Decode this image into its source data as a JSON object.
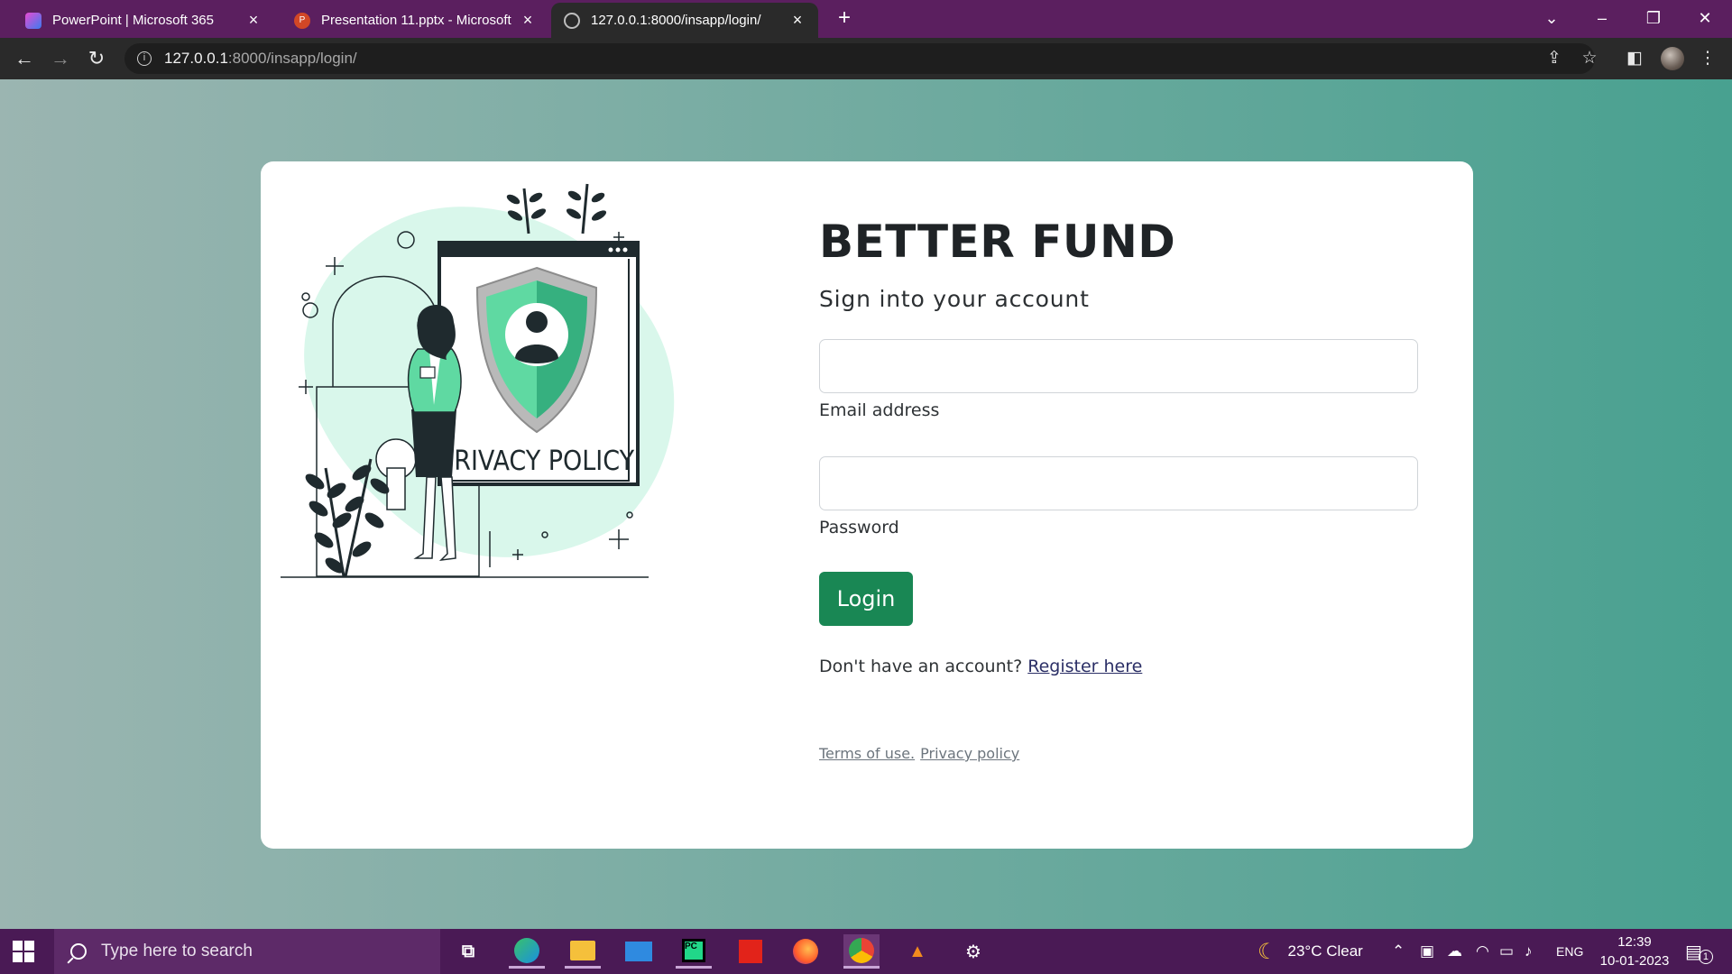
{
  "browser": {
    "tabs": [
      {
        "title": "PowerPoint | Microsoft 365",
        "active": false
      },
      {
        "title": "Presentation 11.pptx - Microsoft",
        "active": false
      },
      {
        "title": "127.0.0.1:8000/insapp/login/",
        "active": true
      }
    ],
    "address": {
      "host": "127.0.0.1",
      "path": ":8000/insapp/login/"
    }
  },
  "illustration": {
    "sign_text": "PRIVACY POLICY"
  },
  "login": {
    "brand": "BETTER FUND",
    "subtitle": "Sign into your account",
    "email_label": "Email address",
    "email_value": "",
    "password_label": "Password",
    "password_value": "",
    "login_button": "Login",
    "register_prompt": "Don't have an account? ",
    "register_link": "Register here",
    "terms_link": "Terms of use.",
    "privacy_link": "Privacy policy"
  },
  "taskbar": {
    "search_placeholder": "Type here to search",
    "weather": "23°C  Clear",
    "language": "ENG",
    "time": "12:39",
    "date": "10-01-2023",
    "notification_count": "1"
  },
  "colors": {
    "tabstrip": "#5b1f5f",
    "page_gradient_start": "#9bb5b1",
    "page_gradient_end": "#48a190",
    "login_button": "#198754",
    "taskbar": "#4a1a55"
  }
}
